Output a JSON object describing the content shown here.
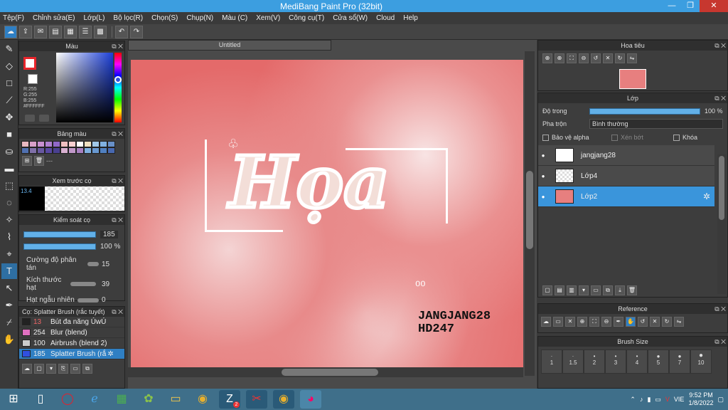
{
  "window": {
    "title": "MediBang Paint Pro (32bit)",
    "min": "—",
    "max": "❐",
    "close": "✕"
  },
  "menu": [
    "Tệp(F)",
    "Chỉnh sửa(E)",
    "Lớp(L)",
    "Bộ lọc(R)",
    "Chọn(S)",
    "Chụp(N)",
    "Màu (C)",
    "Xem(V)",
    "Công cụ(T)",
    "Cửa sổ(W)",
    "Cloud",
    "Help"
  ],
  "canvas": {
    "tab": "Untitled",
    "art_title": "Họa",
    "signature_line1": "JANGJANG28",
    "signature_line2": "HD247"
  },
  "color_panel": {
    "title": "Màu",
    "r": "R:255",
    "g": "G:255",
    "b": "B:255",
    "hex": "#FFFFFF",
    "fg": "#e8252b",
    "bg": "#ffffff"
  },
  "palette_panel": {
    "title": "Bảng màu",
    "colors": [
      "#e8b8c0",
      "#d8a0c8",
      "#c890d0",
      "#b080d0",
      "#9068c8",
      "#f0c0c0",
      "#f8d0d0",
      "#ffffff",
      "#f0e0c0",
      "#a0c8e8",
      "#80b0e0",
      "#6890c8",
      "#5070b0",
      "#8070a8",
      "#6858a0",
      "#5848a0",
      "#4a4090",
      "#d8b0d0",
      "#c098c8",
      "#a880c0",
      "#7fb0e0",
      "#6898d0",
      "#5080c0",
      "#4868b0"
    ]
  },
  "brush_preview": {
    "title": "Xem trước cọ",
    "size": "13.4"
  },
  "brush_control": {
    "title": "Kiểm soát cọ",
    "size_value": "185",
    "opacity_value": "100 %",
    "scatter_label": "Cường độ phân tán",
    "scatter_value": "15",
    "particle_label": "Kích thước hạt",
    "particle_value": "39",
    "random_label": "Hạt ngẫu nhiên",
    "random_value": "0"
  },
  "brush_list": {
    "title": "Cọ: Splatter Brush (rắc tuyết)",
    "items": [
      {
        "num": "13",
        "name": "Bút đa năng ÚwÚ",
        "color": "#222222"
      },
      {
        "num": "254",
        "name": "Blur (blend)",
        "color": "#e070c0"
      },
      {
        "num": "100",
        "name": "Airbrush (blend 2)",
        "color": "#cccccc"
      },
      {
        "num": "185",
        "name": "Splatter Brush (rắ",
        "color": "#3050e0"
      }
    ]
  },
  "navigator": {
    "title": "Hoa tiêu"
  },
  "layers": {
    "title": "Lớp",
    "opacity_label": "Độ trong",
    "opacity_value": "100 %",
    "opacity_fraction": 1.0,
    "blend_label": "Pha trộn",
    "blend_value": "Bình thường",
    "protect_alpha": "Bảo vệ alpha",
    "clip": "Xén bớt",
    "lock": "Khóa",
    "items": [
      {
        "name": "jangjang28",
        "selected": false
      },
      {
        "name": "Lớp4",
        "selected": false
      },
      {
        "name": "Lớp2",
        "selected": true
      }
    ]
  },
  "reference": {
    "title": "Reference"
  },
  "brush_size": {
    "title": "Brush Size",
    "sizes": [
      "1",
      "1.5",
      "2",
      "3",
      "4",
      "5",
      "7",
      "10"
    ]
  },
  "taskbar": {
    "lang": "VIE",
    "time": "9:52 PM",
    "date": "1/8/2022",
    "zalo_badge": "2"
  }
}
